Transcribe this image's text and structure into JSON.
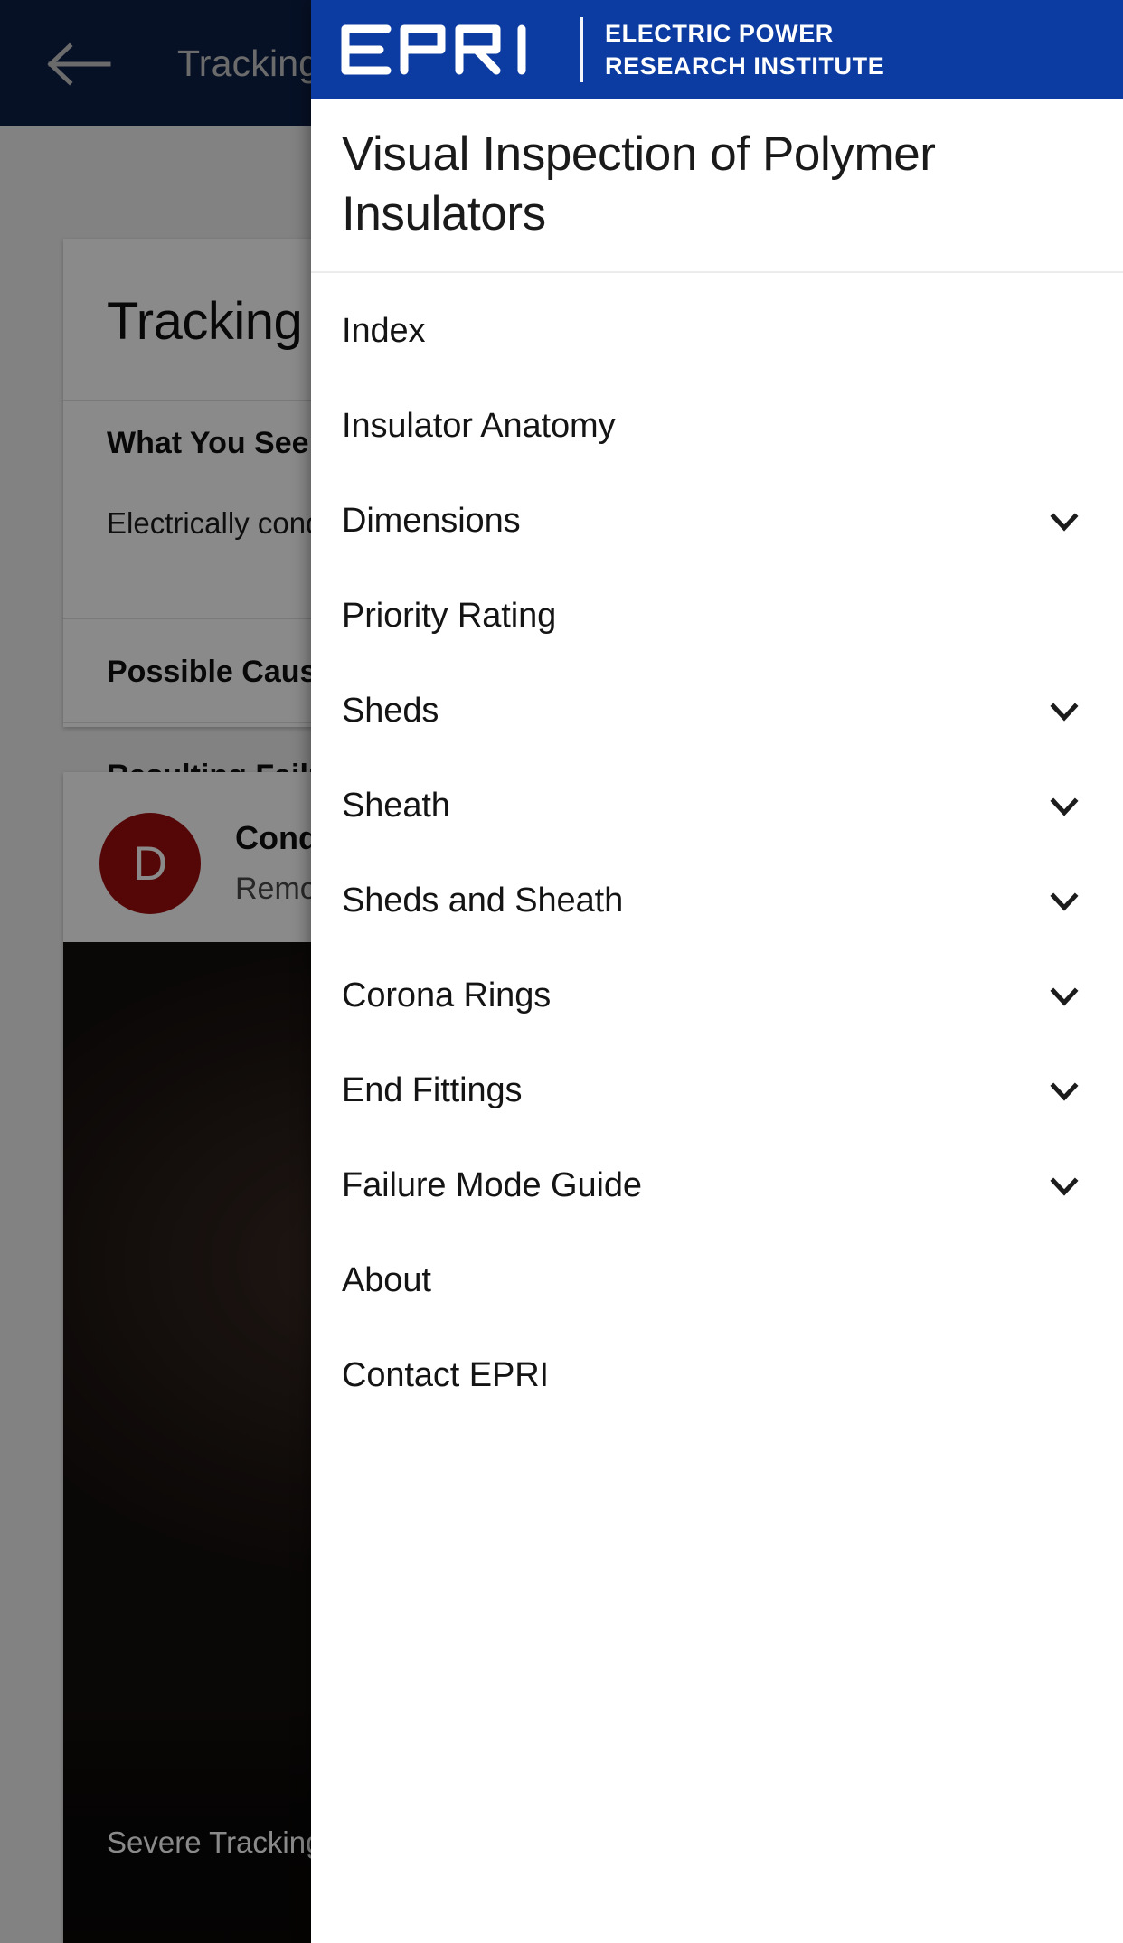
{
  "background_app": {
    "appbar": {
      "back_icon": "arrow-left-icon",
      "title": "Tracking"
    },
    "tracking_card": {
      "title": "Tracking",
      "sections": [
        {
          "heading": "What You See",
          "body": "Electrically conductive paths on the sheds and/or sheath"
        },
        {
          "heading": "Possible Cause",
          "body": ""
        },
        {
          "heading": "Resulting Failure",
          "body": ""
        }
      ]
    },
    "action_card": {
      "badge_letter": "D",
      "title": "Conductive Path",
      "subtitle": "Remove polymer insulator",
      "photo_caption": "Severe Tracking (in"
    }
  },
  "drawer": {
    "brand": {
      "logo_alt": "EPRI",
      "line1": "ELECTRIC POWER",
      "line2": "RESEARCH INSTITUTE",
      "bar_color": "#0c3ba2"
    },
    "title": "Visual Inspection of Polymer Insulators",
    "menu": [
      {
        "label": "Index",
        "expandable": false
      },
      {
        "label": "Insulator Anatomy",
        "expandable": false
      },
      {
        "label": "Dimensions",
        "expandable": true
      },
      {
        "label": "Priority Rating",
        "expandable": false
      },
      {
        "label": "Sheds",
        "expandable": true
      },
      {
        "label": "Sheath",
        "expandable": true
      },
      {
        "label": "Sheds and Sheath",
        "expandable": true
      },
      {
        "label": "Corona Rings",
        "expandable": true
      },
      {
        "label": "End Fittings",
        "expandable": true
      },
      {
        "label": "Failure Mode Guide",
        "expandable": true
      },
      {
        "label": "About",
        "expandable": false
      },
      {
        "label": "Contact EPRI",
        "expandable": false
      }
    ]
  }
}
